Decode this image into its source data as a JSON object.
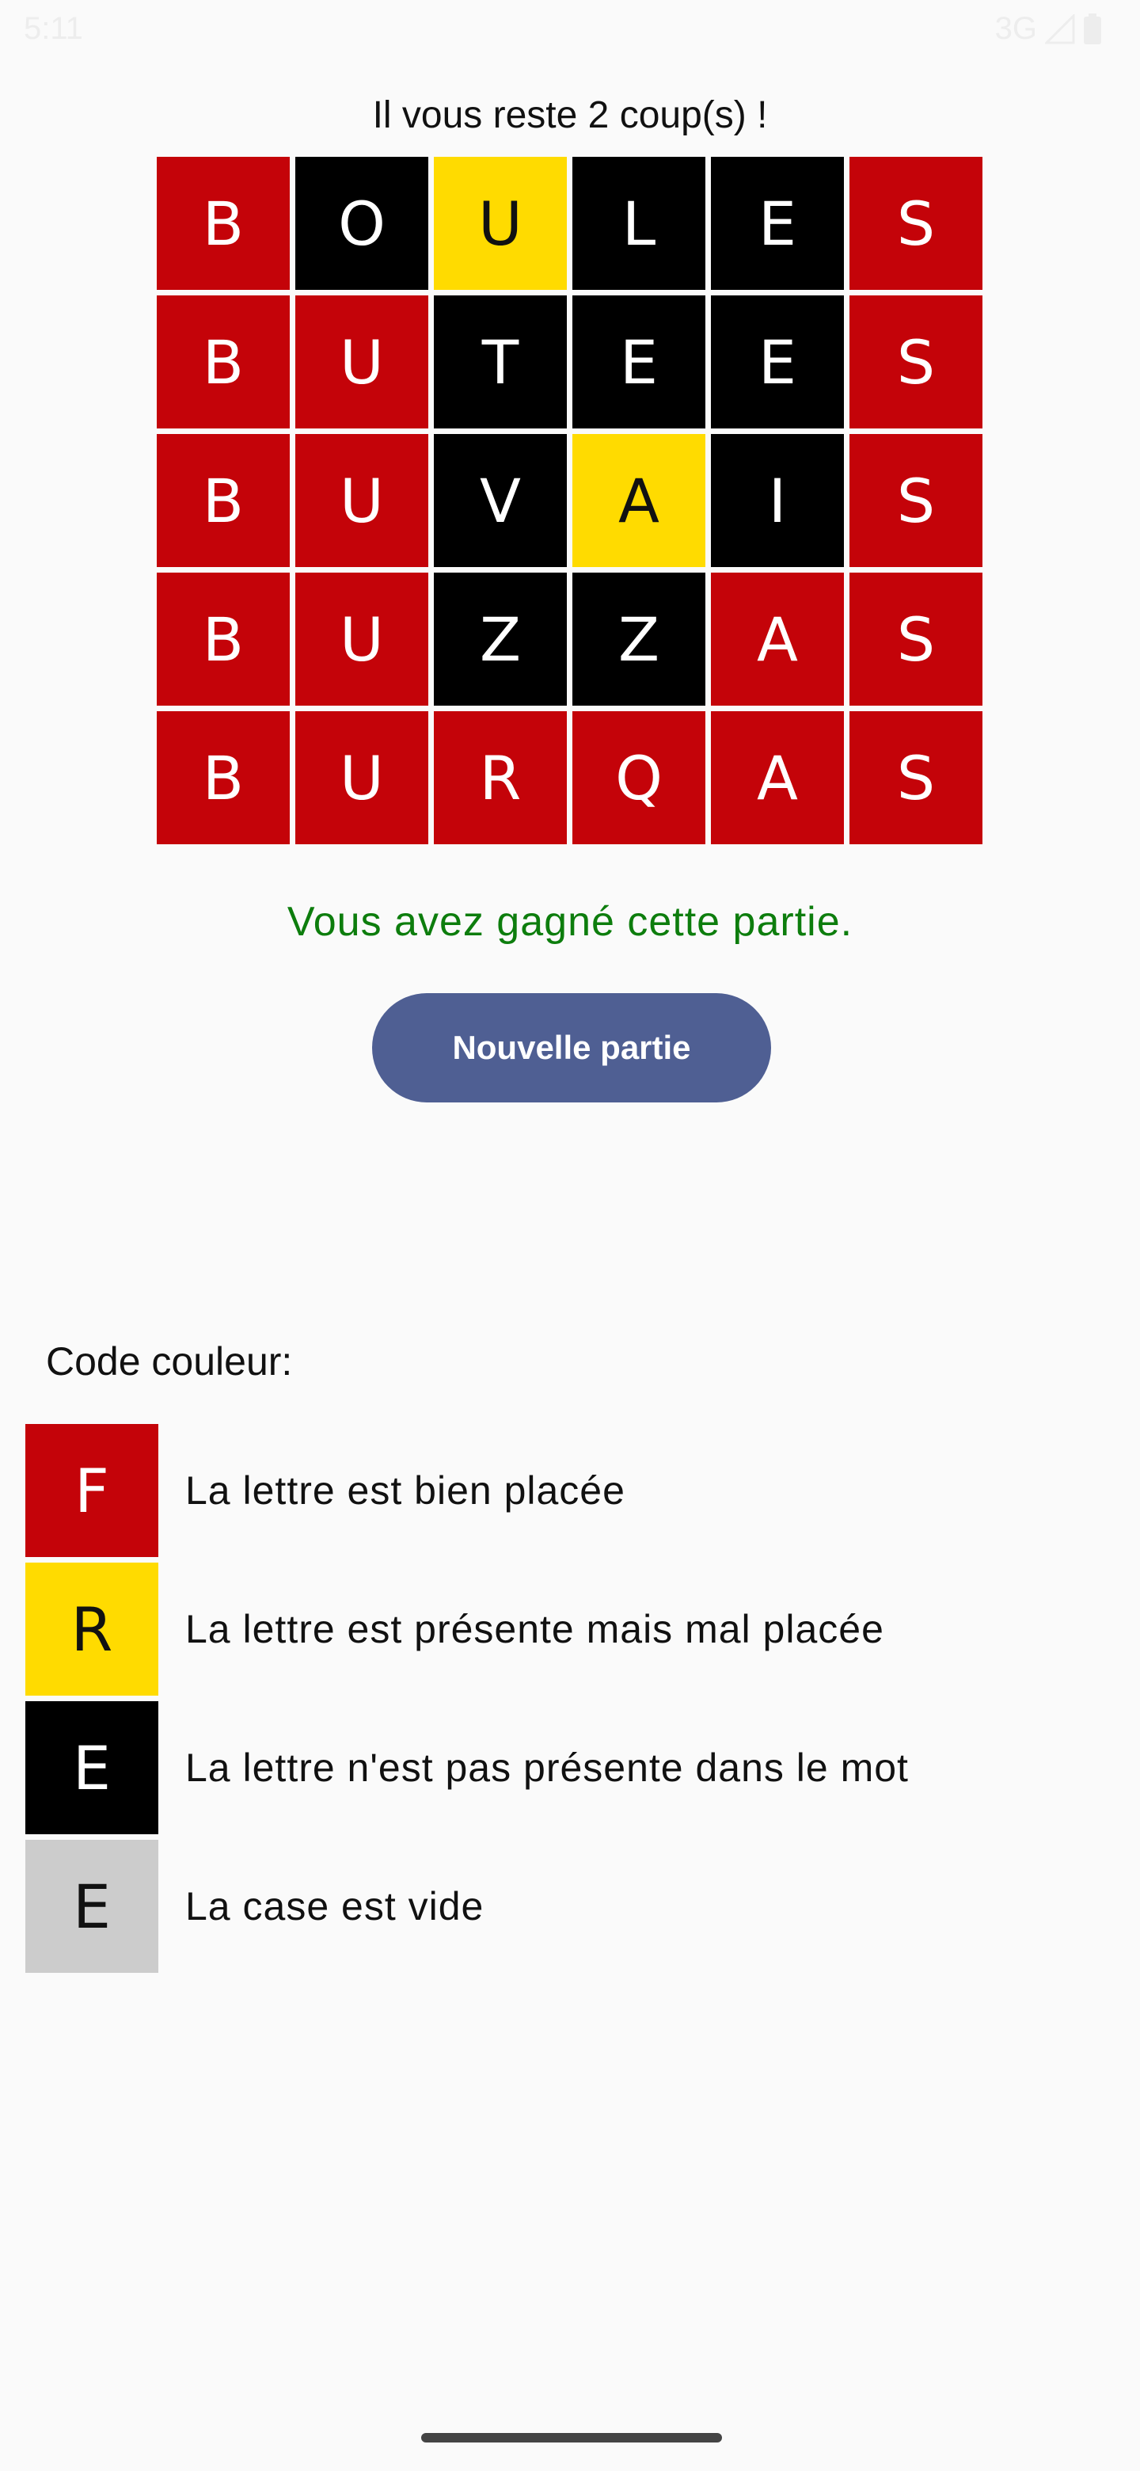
{
  "status_bar": {
    "time": "5:11",
    "network": "3G",
    "icons": [
      "signal-icon",
      "battery-icon"
    ]
  },
  "game": {
    "remaining_text": "Il vous reste 2 coup(s) !",
    "board": [
      [
        {
          "letter": "B",
          "state": "red"
        },
        {
          "letter": "O",
          "state": "black"
        },
        {
          "letter": "U",
          "state": "yellow"
        },
        {
          "letter": "L",
          "state": "black"
        },
        {
          "letter": "E",
          "state": "black"
        },
        {
          "letter": "S",
          "state": "red"
        }
      ],
      [
        {
          "letter": "B",
          "state": "red"
        },
        {
          "letter": "U",
          "state": "red"
        },
        {
          "letter": "T",
          "state": "black"
        },
        {
          "letter": "E",
          "state": "black"
        },
        {
          "letter": "E",
          "state": "black"
        },
        {
          "letter": "S",
          "state": "red"
        }
      ],
      [
        {
          "letter": "B",
          "state": "red"
        },
        {
          "letter": "U",
          "state": "red"
        },
        {
          "letter": "V",
          "state": "black"
        },
        {
          "letter": "A",
          "state": "yellow"
        },
        {
          "letter": "I",
          "state": "black"
        },
        {
          "letter": "S",
          "state": "red"
        }
      ],
      [
        {
          "letter": "B",
          "state": "red"
        },
        {
          "letter": "U",
          "state": "red"
        },
        {
          "letter": "Z",
          "state": "black"
        },
        {
          "letter": "Z",
          "state": "black"
        },
        {
          "letter": "A",
          "state": "red"
        },
        {
          "letter": "S",
          "state": "red"
        }
      ],
      [
        {
          "letter": "B",
          "state": "red"
        },
        {
          "letter": "U",
          "state": "red"
        },
        {
          "letter": "R",
          "state": "red"
        },
        {
          "letter": "Q",
          "state": "red"
        },
        {
          "letter": "A",
          "state": "red"
        },
        {
          "letter": "S",
          "state": "red"
        }
      ]
    ],
    "win_message": "Vous avez gagné cette partie.",
    "new_game_label": "Nouvelle partie"
  },
  "legend": {
    "title": "Code couleur:",
    "items": [
      {
        "letter": "F",
        "state": "red",
        "text": "La lettre est bien placée"
      },
      {
        "letter": "R",
        "state": "yellow",
        "text": "La lettre est présente mais mal placée"
      },
      {
        "letter": "E",
        "state": "black",
        "text": "La lettre n'est pas présente dans le mot"
      },
      {
        "letter": "E",
        "state": "gray",
        "text": "La case est vide"
      }
    ]
  },
  "colors": {
    "red": "#c40309",
    "yellow": "#ffdb00",
    "black": "#000000",
    "gray": "#cccccc",
    "win_text": "#0d7d0d",
    "button": "#4f5f93"
  }
}
